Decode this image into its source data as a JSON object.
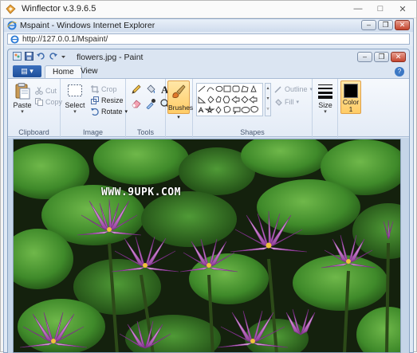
{
  "outer_window": {
    "title": "Winflector v.3.9.6.5",
    "controls": [
      "—",
      "□",
      "✕"
    ]
  },
  "ie_window": {
    "title": "Mspaint - Windows Internet Explorer",
    "address": "http://127.0.0.1/Mspaint/"
  },
  "paint_window": {
    "title": "flowers.jpg - Paint",
    "file_tab": "▤ ▾",
    "tabs": [
      {
        "label": "Home",
        "active": true
      },
      {
        "label": "View",
        "active": false
      }
    ],
    "help": "?"
  },
  "ribbon": {
    "clipboard": {
      "group_label": "Clipboard",
      "paste": "Paste",
      "cut": "Cut",
      "copy": "Copy"
    },
    "image": {
      "group_label": "Image",
      "select": "Select",
      "crop": "Crop",
      "resize": "Resize",
      "rotate": "Rotate"
    },
    "tools": {
      "group_label": "Tools"
    },
    "brushes": {
      "label": "Brushes"
    },
    "shapes": {
      "group_label": "Shapes",
      "outline": "Outline",
      "fill": "Fill"
    },
    "size": {
      "label": "Size"
    },
    "color": {
      "label": "Color",
      "sub_label": "1",
      "value": "#000000"
    }
  },
  "canvas": {
    "watermark": "WWW.9UPK.COM",
    "image_name": "flowers.jpg"
  },
  "colors": {
    "ribbon_bg": "#eef3fa",
    "accent_orange": "#ffcc66",
    "title_blue": "#1d4f9a"
  }
}
